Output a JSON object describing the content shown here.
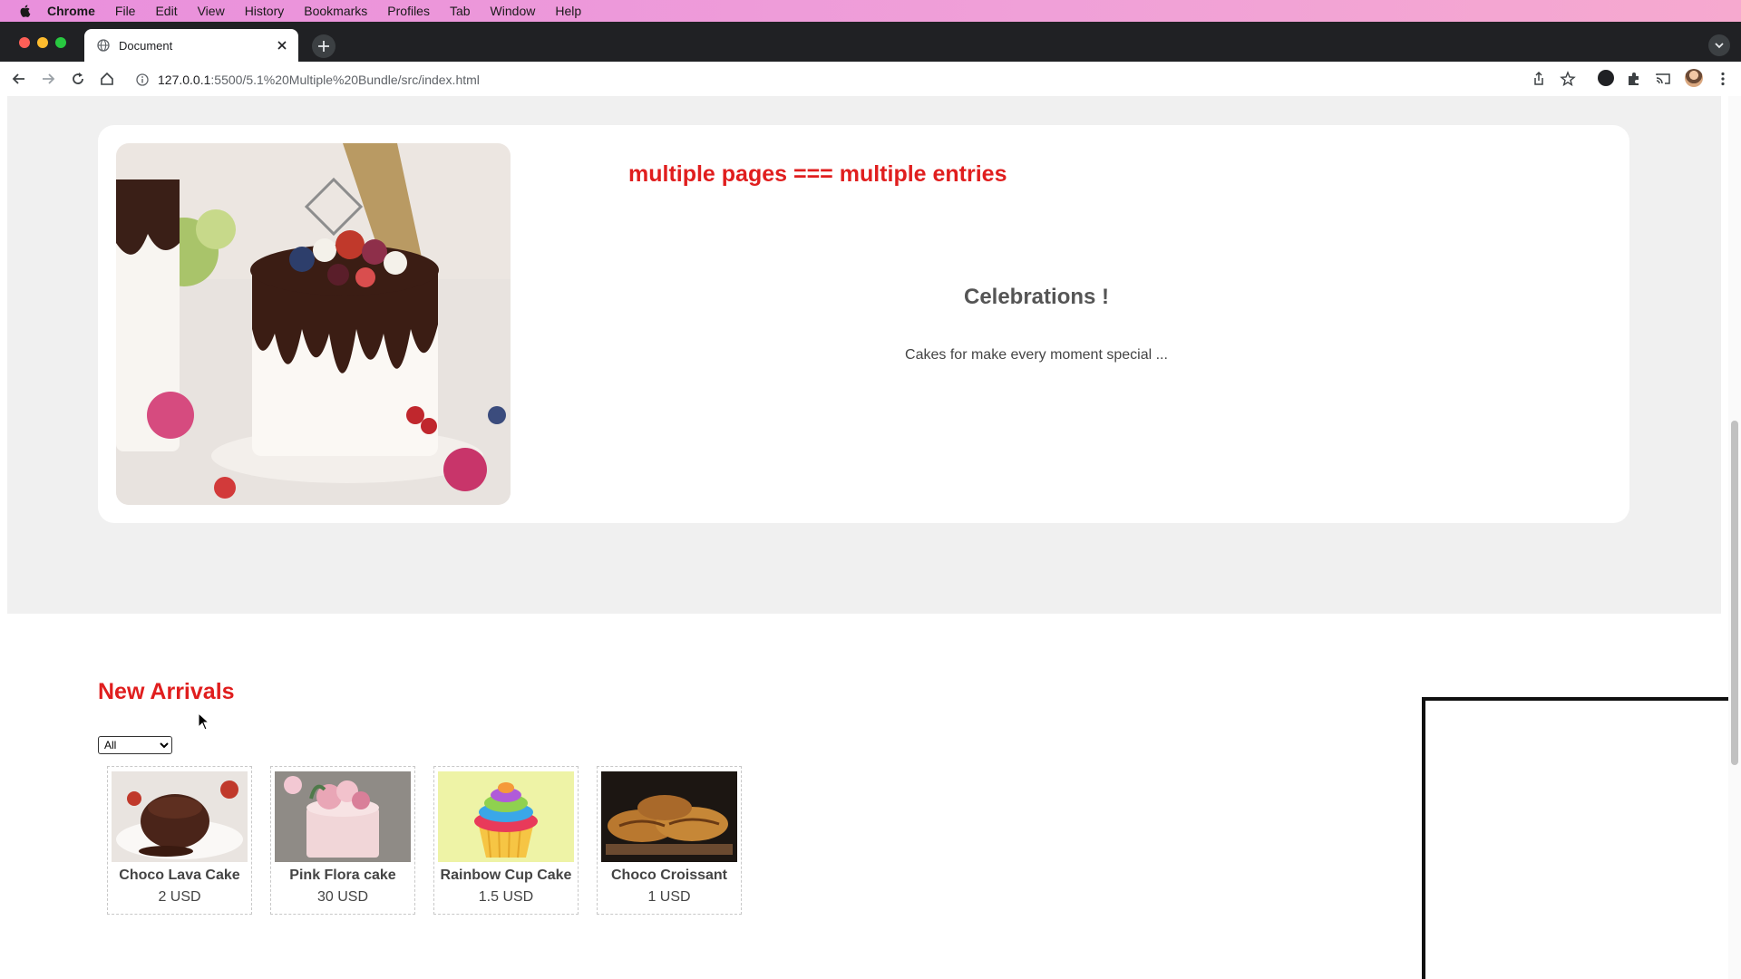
{
  "menubar": {
    "app": "Chrome",
    "items": [
      "File",
      "Edit",
      "View",
      "History",
      "Bookmarks",
      "Profiles",
      "Tab",
      "Window",
      "Help"
    ]
  },
  "browser": {
    "tab_title": "Document",
    "url_host": "127.0.0.1",
    "url_path": ":5500/5.1%20Multiple%20Bundle/src/index.html"
  },
  "hero": {
    "tagline": "multiple pages === multiple entries",
    "title": "Celebrations !",
    "subtitle": "Cakes for make every moment special ..."
  },
  "new_arrivals": {
    "title": "New Arrivals",
    "filter_selected": "All",
    "products": [
      {
        "name": "Choco Lava Cake",
        "price": "2 USD"
      },
      {
        "name": "Pink Flora cake",
        "price": "30 USD"
      },
      {
        "name": "Rainbow Cup Cake",
        "price": "1.5 USD"
      },
      {
        "name": "Choco Croissant",
        "price": "1 USD"
      }
    ]
  },
  "colors": {
    "accent_red": "#e01e1e",
    "band_gray": "#f0f0f0",
    "chrome_dark": "#202124"
  }
}
